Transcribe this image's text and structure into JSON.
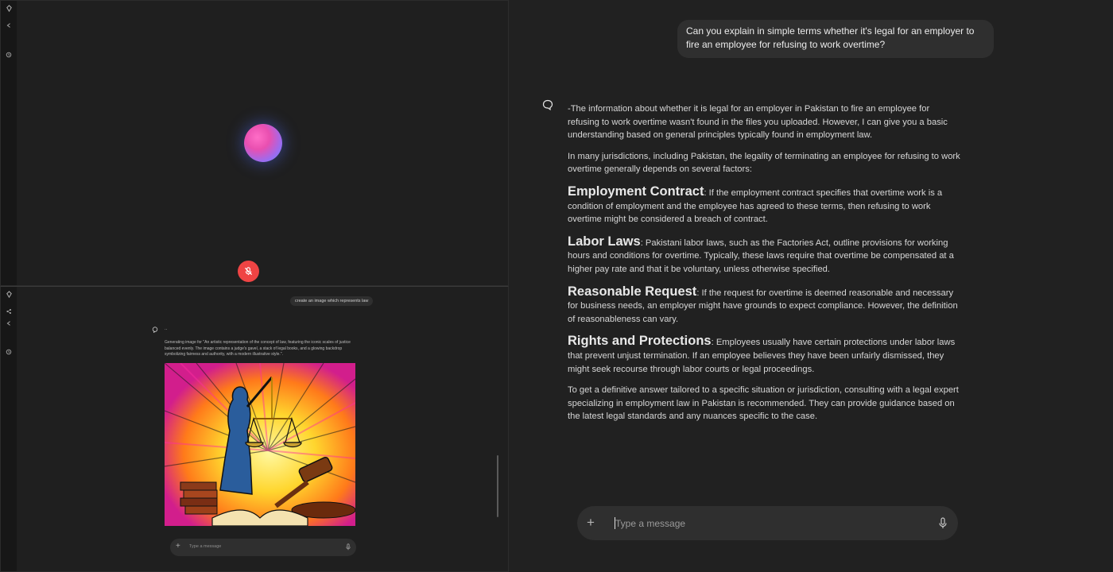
{
  "voice_pane": {
    "mic_state": "muted"
  },
  "mini_chat": {
    "user_message": "create an image which represents law",
    "bot_status": "..",
    "generating_text": "Generating image for \"An artistic representation of the concept of law, featuring the iconic scales of justice balanced evenly. The image contains a judge's gavel, a stack of legal books, and a glowing backdrop symbolizing fairness and authority, with a modern illustrative style.\".",
    "input_placeholder": "Type a message"
  },
  "chat": {
    "user_message": "Can you explain in simple terms whether it's legal for an employer to fire an employee for refusing to work overtime?",
    "intro_1": "-The information about whether it is legal for an employer in Pakistan to fire an employee for refusing to work overtime wasn't found in the files you uploaded. However, I can give you a basic understanding based on general principles typically found in employment law.",
    "intro_2": "In many jurisdictions, including Pakistan, the legality of terminating an employee for refusing to work overtime generally depends on several factors:",
    "sections": [
      {
        "heading": "Employment Contract",
        "body": ": If the employment contract specifies that overtime work is a condition of employment and the employee has agreed to these terms, then refusing to work overtime might be considered a breach of contract."
      },
      {
        "heading": "Labor Laws",
        "body": ": Pakistani labor laws, such as the Factories Act, outline provisions for working hours and conditions for overtime. Typically, these laws require that overtime be compensated at a higher pay rate and that it be voluntary, unless otherwise specified."
      },
      {
        "heading": "Reasonable Request",
        "body": ": If the request for overtime is deemed reasonable and necessary for business needs, an employer might have grounds to expect compliance. However, the definition of reasonableness can vary."
      },
      {
        "heading": "Rights and Protections",
        "body": ": Employees usually have certain protections under labor laws that prevent unjust termination. If an employee believes they have been unfairly dismissed, they might seek recourse through labor courts or legal proceedings."
      }
    ],
    "conclusion": "To get a definitive answer tailored to a specific situation or jurisdiction, consulting with a legal expert specializing in employment law in Pakistan is recommended. They can provide guidance based on the latest legal standards and any nuances specific to the case.",
    "input_placeholder": "Type a message"
  },
  "icons": {
    "rail_top": [
      "logo-icon",
      "back-icon",
      "history-icon"
    ],
    "rail_bottom": [
      "logo-icon",
      "share-icon",
      "back-icon",
      "history-icon"
    ]
  },
  "colors": {
    "mic_off": "#ef4444",
    "background": "#212121",
    "bubble": "#2f2f2f"
  }
}
